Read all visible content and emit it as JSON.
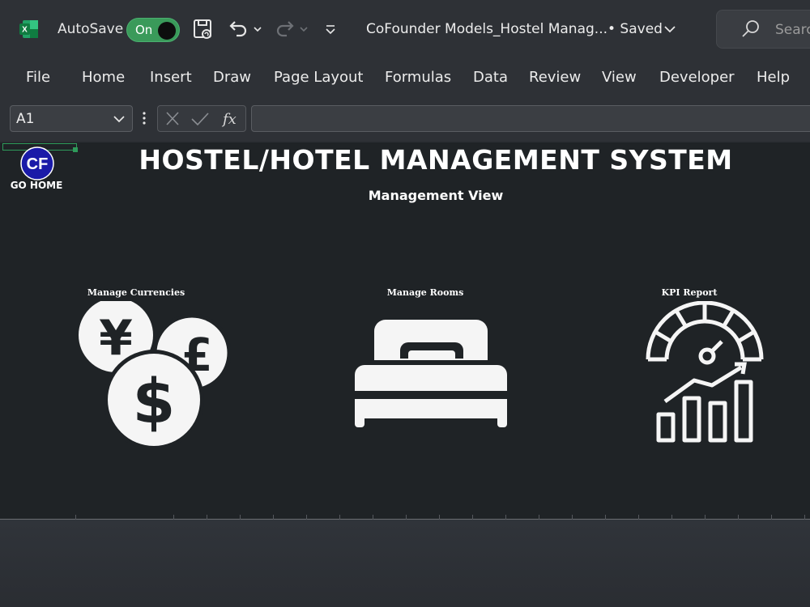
{
  "titlebar": {
    "autosave_label": "AutoSave",
    "toggle_state": "On",
    "document_title": "CoFounder Models_Hostel Manag...",
    "saved_status": "• Saved",
    "search_placeholder": "Search"
  },
  "ribbon": {
    "tabs": [
      "File",
      "Home",
      "Insert",
      "Draw",
      "Page Layout",
      "Formulas",
      "Data",
      "Review",
      "View",
      "Developer",
      "Help"
    ]
  },
  "formula_bar": {
    "name_box": "A1",
    "formula": ""
  },
  "sheet": {
    "logo_text": "CF",
    "go_home": "GO HOME",
    "title": "HOSTEL/HOTEL MANAGEMENT SYSTEM",
    "subtitle": "Management View",
    "tiles": [
      {
        "label": "Manage Currencies",
        "icon": "currency-icon"
      },
      {
        "label": "Manage Rooms",
        "icon": "bed-icon"
      },
      {
        "label": "KPI Report",
        "icon": "kpi-gauge-icon"
      }
    ]
  },
  "colors": {
    "sheet_bg": "#1f2326",
    "chrome_bg": "#2e3136",
    "toggle_on": "#3a9a5a",
    "logo_blue": "#1a1aa8"
  }
}
